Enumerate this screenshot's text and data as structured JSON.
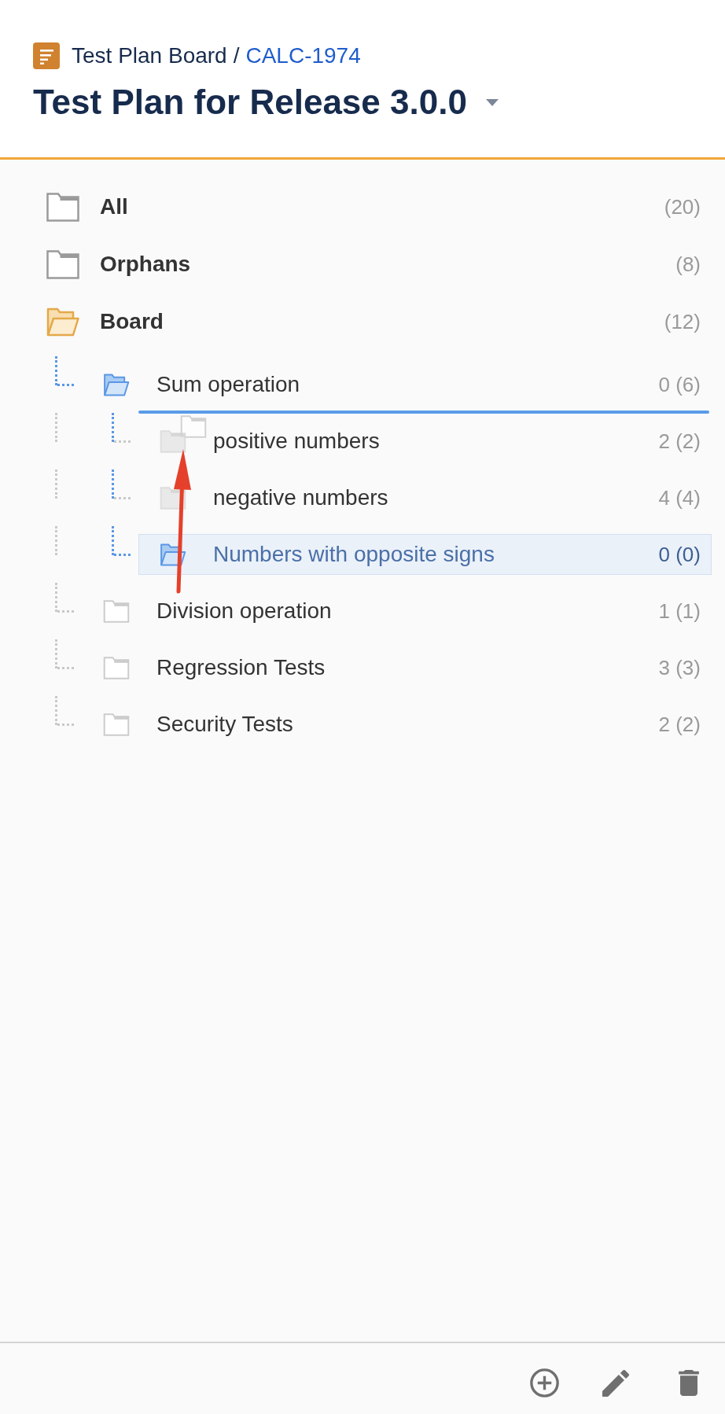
{
  "header": {
    "breadcrumb": {
      "parent": "Test Plan Board",
      "separator": "/",
      "issue_key": "CALC-1974"
    },
    "title": "Test Plan for Release 3.0.0"
  },
  "tree": {
    "items": [
      {
        "kind": "filter",
        "label": "All",
        "count": "(20)",
        "expanded": false,
        "selected": false
      },
      {
        "kind": "filter",
        "label": "Orphans",
        "count": "(8)",
        "expanded": false,
        "selected": false
      },
      {
        "kind": "board",
        "label": "Board",
        "count": "(12)",
        "expanded": true,
        "selected": false,
        "children": [
          {
            "kind": "folder",
            "label": "Sum operation",
            "count": "0 (6)",
            "expanded": true,
            "selected": false,
            "drop_target": true,
            "children": [
              {
                "kind": "folder",
                "label": "positive numbers",
                "count": "2 (2)",
                "expanded": false,
                "selected": false
              },
              {
                "kind": "folder",
                "label": "negative numbers",
                "count": "4 (4)",
                "expanded": false,
                "selected": false
              },
              {
                "kind": "folder",
                "label": "Numbers with opposite signs",
                "count": "0 (0)",
                "expanded": false,
                "selected": true
              }
            ]
          },
          {
            "kind": "folder",
            "label": "Division operation",
            "count": "1 (1)",
            "expanded": false,
            "selected": false,
            "drop_target": false
          },
          {
            "kind": "folder",
            "label": "Regression Tests",
            "count": "3 (3)",
            "expanded": false,
            "selected": false,
            "drop_target": false
          },
          {
            "kind": "folder",
            "label": "Security Tests",
            "count": "2 (2)",
            "expanded": false,
            "selected": false,
            "drop_target": false
          }
        ]
      }
    ]
  }
}
